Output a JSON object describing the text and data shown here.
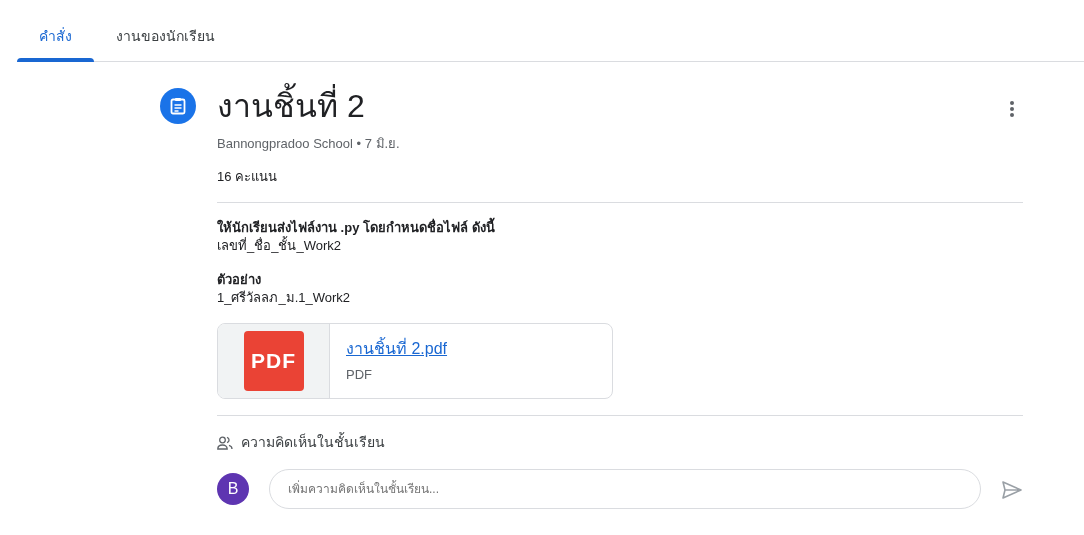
{
  "tabs": [
    {
      "label": "คำสั่ง",
      "selected": true
    },
    {
      "label": "งานของนักเรียน",
      "selected": false
    }
  ],
  "assignment": {
    "title": "งานชิ้นที่ 2",
    "meta": "Bannongpradoo School • 7 มิ.ย.",
    "points": "16 คะแนน",
    "instructions": [
      {
        "heading": "ให้นักเรียนส่งไฟล์งาน .py โดยกำหนดชื่อไฟล์ ดังนี้",
        "body": "เลขที่_ชื่อ_ชั้น_Work2"
      },
      {
        "heading": "ตัวอย่าง",
        "body": "1_ศรีวัลลภ_ม.1_Work2"
      }
    ],
    "attachment": {
      "icon_label": "PDF",
      "name": "งานชิ้นที่ 2.pdf",
      "type": "PDF"
    }
  },
  "comments": {
    "heading": "ความคิดเห็นในชั้นเรียน",
    "avatar": "B",
    "placeholder": "เพิ่มความคิดเห็นในชั้นเรียน..."
  }
}
